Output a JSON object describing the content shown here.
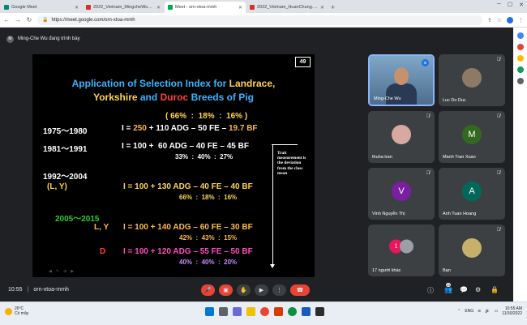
{
  "browser": {
    "tabs": [
      {
        "label": "Google Meet",
        "favicon_color": "#00897b",
        "active": false
      },
      {
        "label": "2022_Vietnam_MingcheWu_20221...",
        "favicon_color": "#d93025",
        "active": false
      },
      {
        "label": "Meet - orn-xtoa-mmh",
        "favicon_color": "#00ac47",
        "active": true
      },
      {
        "label": "2022_Vietnam_HuanChung.p...",
        "favicon_color": "#d93025",
        "active": false
      }
    ],
    "new_tab": "+",
    "url": "https://meet.google.com/orn-xtoa-mmh"
  },
  "meet": {
    "presenter_initial": "M",
    "presenter_status": "Ming-Che Wu đang trình bày",
    "meeting_time": "10:55",
    "meeting_code": "orn-xtoa-mmh",
    "people_count": "22"
  },
  "slide": {
    "number": "49",
    "title_line1_a": "Application of Selection Index for ",
    "title_line1_b": "Landrace,",
    "title_line2_a": "Yorkshire",
    "title_line2_b": " and ",
    "title_line2_c": "Duroc",
    "title_line2_d": " Breeds of Pig",
    "weights_top": "( 66%  :  18%  :  16% )",
    "row1_period": "1975～1980",
    "row1_a": "I = ",
    "row1_b": "250",
    "row1_c": " + 110 ADG – 50 FE – ",
    "row1_d": "19.7 BF",
    "row2_period": "1981～1991",
    "row2_formula": "I = 100 +  60 ADG – 40 FE – 45 BF",
    "row2_weights": "33%  :  40%  :  27%",
    "row3_period": "1992～2004",
    "row3_breed": "(L, Y)",
    "row3_formula": "I = 100 + 130 ADG – 40 FE – 40 BF",
    "row3_weights": "66%  :  18%  :  16%",
    "row4_period": "2005～2015",
    "row4_breed": "L, Y",
    "row4_formula": "I = 100 + 140 ADG – 60 FE – 30 BF",
    "row4_weights": "42%  :  43%  :  15%",
    "row5_breed": "D",
    "row5_formula": "I = 100 + 120 ADG – 55 FE – 50 BF",
    "row5_weights": "40%  :  40%  :  20%",
    "note": "Trait measurement is the deviation from the class mean"
  },
  "participants": [
    {
      "name": "Ming-Che Wu",
      "speaking": true
    },
    {
      "name": "Luc Do Duc"
    },
    {
      "name": "thuha tran"
    },
    {
      "name": "Manh Tran Xuan",
      "initial": "M",
      "color": "#33691e"
    },
    {
      "name": "Vinh Nguyễn Thị",
      "initial": "V",
      "color": "#7b1fa2"
    },
    {
      "name": "Anh Tuan Hoang",
      "initial": "A",
      "color": "#00695c"
    },
    {
      "name": "17 người khác",
      "initial": "1"
    },
    {
      "name": "Bạn"
    }
  ],
  "taskbar": {
    "temperature": "26°C",
    "weather": "Có mây",
    "lang": "ENG",
    "time": "10:55 AM",
    "date": "11/30/2022"
  },
  "colors": {
    "title_blue": "#38b6ff",
    "yellow": "#ffd54f",
    "orange": "#ffb84d",
    "red": "#ff4040",
    "green": "#33cc33",
    "pink": "#ff4fbf",
    "violet": "#c98bff"
  }
}
